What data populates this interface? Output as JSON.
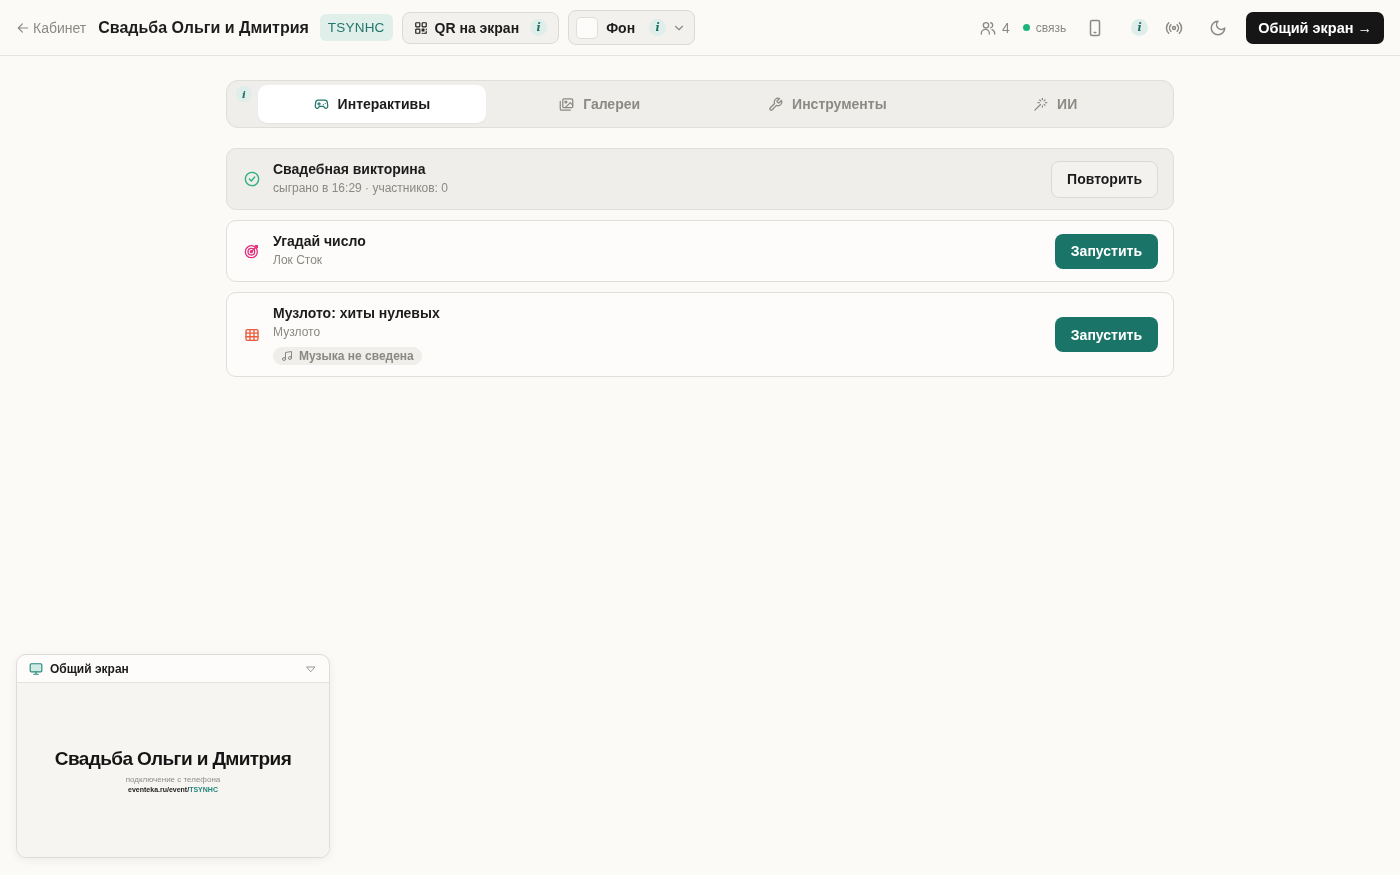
{
  "header": {
    "back_link": {
      "label": "Кабинет"
    },
    "title": "Свадьба Ольги и Дмитрия",
    "event_code": "TSYNHC",
    "qr_button": {
      "label": "QR на экран",
      "info": "i"
    },
    "background_select": {
      "label": "Фон",
      "info": "i"
    },
    "participants": {
      "count": "4"
    },
    "connection": {
      "label": "связь",
      "connected": true
    },
    "info": "i",
    "share_button": {
      "label": "Общий экран →"
    }
  },
  "tabs_info": "i",
  "tabs": [
    {
      "label": "Интерактивы",
      "selected": true
    },
    {
      "label": "Галереи",
      "selected": false
    },
    {
      "label": "Инструменты",
      "selected": false
    },
    {
      "label": "ИИ",
      "selected": false
    }
  ],
  "games": [
    {
      "kind": "quiz",
      "title": "Свадебная викторина",
      "subtitle": "сыграно в 16:29 · участников: 0",
      "played": true,
      "button": "Повторить"
    },
    {
      "kind": "guess",
      "title": "Угадай число",
      "subtitle": "Лок Сток",
      "played": false,
      "button": "Запустить"
    },
    {
      "kind": "lotto",
      "title": "Музлото: хиты нулевых",
      "subtitle": "Музлото",
      "played": false,
      "button": "Запустить",
      "tag": "Музыка не сведена"
    }
  ],
  "preview": {
    "title": "Общий экран",
    "expanded": true,
    "screen": {
      "title": "Свадьба Ольги и Дмитрия",
      "hint": "подключение с телефона",
      "url": "eventeka.ru/event/",
      "code": "TSYNHC"
    }
  }
}
